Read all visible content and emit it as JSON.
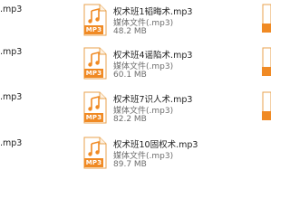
{
  "files": [
    {
      "name": "权术班1韬晦术.mp3",
      "type": "媒体文件(.mp3)",
      "size": "48.2 MB",
      "icon_label": "MP3"
    },
    {
      "name": "权术班4谣陷术.mp3",
      "type": "媒体文件(.mp3)",
      "size": "60.1 MB",
      "icon_label": "MP3"
    },
    {
      "name": "权术班7识人术.mp3",
      "type": "媒体文件(.mp3)",
      "size": "82.2 MB",
      "icon_label": "MP3"
    },
    {
      "name": "权术班10固权术.mp3",
      "type": "媒体文件(.mp3)",
      "size": "89.7 MB",
      "icon_label": "MP3"
    }
  ],
  "left_column": [
    {
      "name": ".mp3"
    },
    {
      "name": ".mp3"
    },
    {
      "name": ".mp3"
    },
    {
      "name": ".mp3"
    }
  ],
  "icon": "music-file-icon",
  "colors": {
    "accent": "#f08a24",
    "text": "#222222",
    "muted": "#6d6d6d"
  }
}
